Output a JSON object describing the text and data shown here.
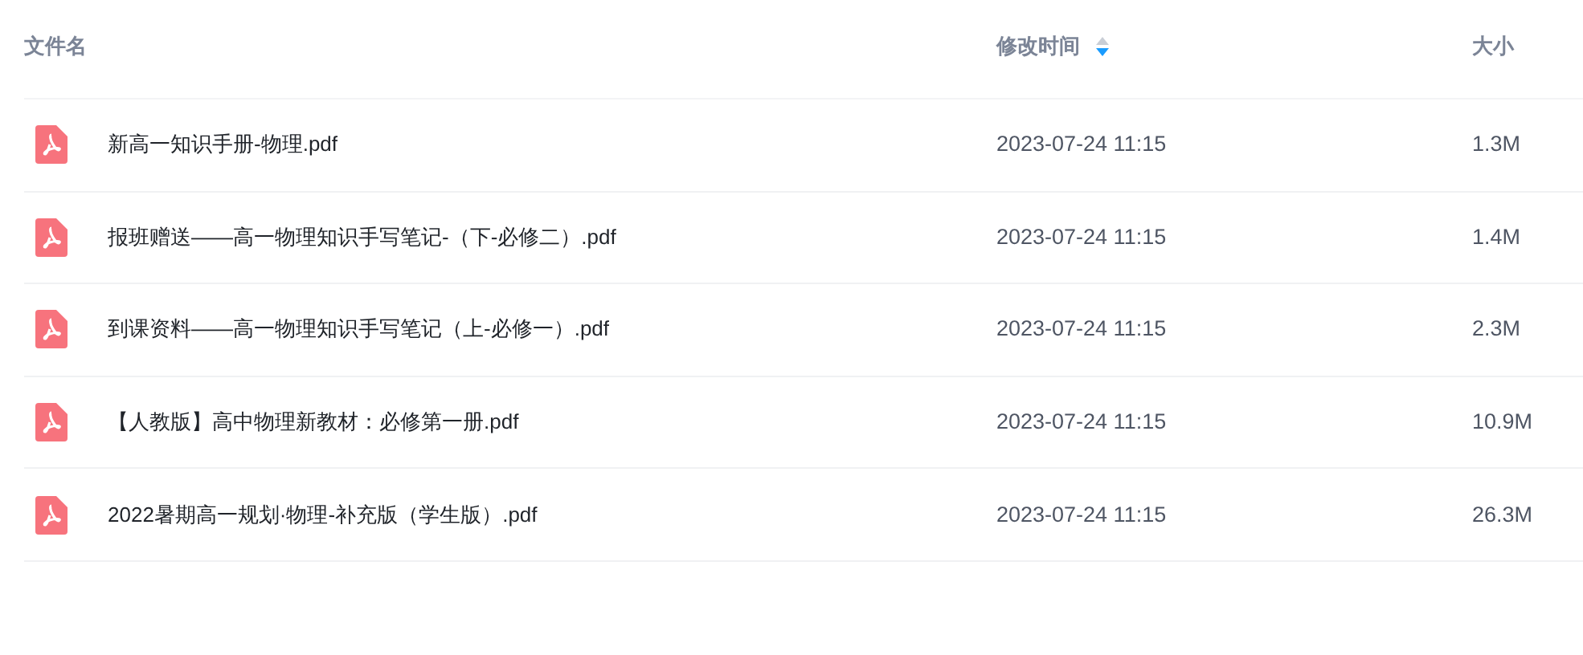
{
  "table": {
    "columns": [
      {
        "label": "文件名"
      },
      {
        "label": "修改时间",
        "sorted": true,
        "descending": true
      },
      {
        "label": "大小"
      }
    ],
    "rows": [
      {
        "kind": "pdf",
        "name": "新高一知识手册-物理.pdf",
        "modified": "2023-07-24 11:15",
        "size": "1.3M"
      },
      {
        "kind": "pdf",
        "name": "报班赠送——高一物理知识手写笔记-（下-必修二）.pdf",
        "modified": "2023-07-24 11:15",
        "size": "1.4M"
      },
      {
        "kind": "pdf",
        "name": "到课资料——高一物理知识手写笔记（上-必修一）.pdf",
        "modified": "2023-07-24 11:15",
        "size": "2.3M"
      },
      {
        "kind": "pdf",
        "name": "【人教版】高中物理新教材：必修第一册.pdf",
        "modified": "2023-07-24 11:15",
        "size": "10.9M"
      },
      {
        "kind": "pdf",
        "name": "2022暑期高一规划·物理-补充版（学生版）.pdf",
        "modified": "2023-07-24 11:15",
        "size": "26.3M"
      }
    ]
  }
}
